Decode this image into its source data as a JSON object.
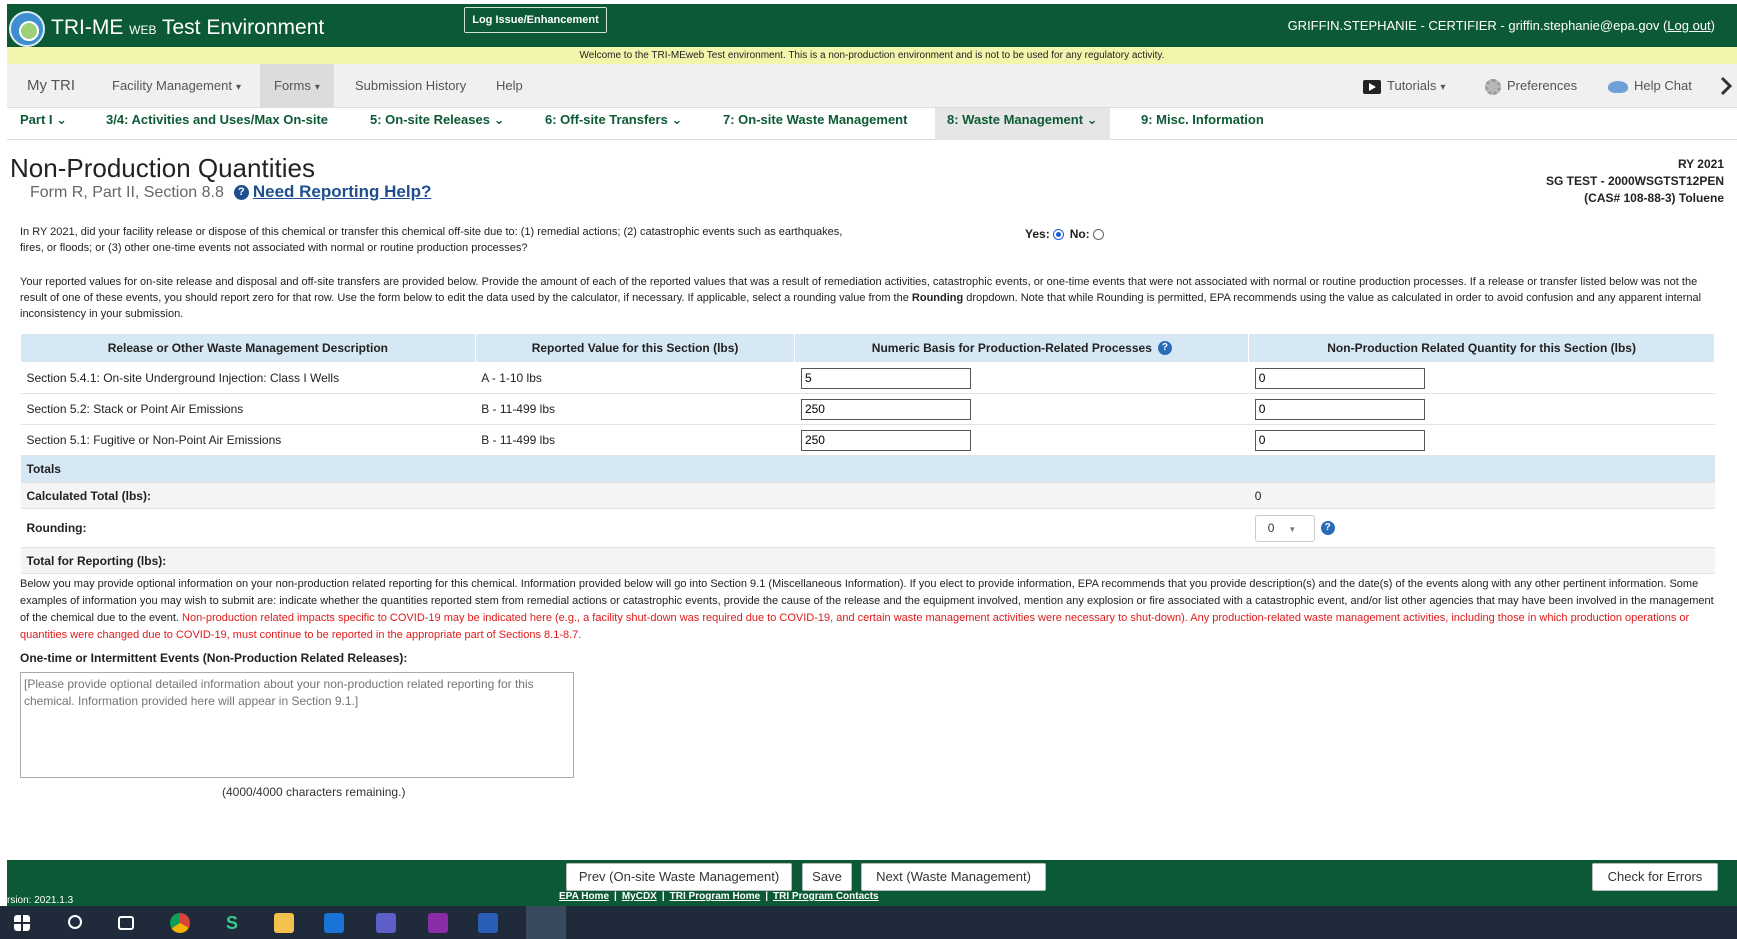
{
  "header": {
    "app_title_pre": "TRI-ME",
    "app_title_web": "WEB",
    "app_title_post": "Test Environment",
    "log_issue": "Log Issue/Enhancement",
    "user_text": "GRIFFIN.STEPHANIE - CERTIFIER - griffin.stephanie@epa.gov (",
    "logout": "Log out",
    "user_close": ")"
  },
  "welcome": "Welcome to the TRI-MEweb Test environment. This is a non-production environment and is not to be used for any regulatory activity.",
  "mainnav": {
    "my_tri": "My TRI",
    "facility": "Facility Management",
    "forms": "Forms",
    "history": "Submission History",
    "help": "Help",
    "tutorials": "Tutorials",
    "preferences": "Preferences",
    "help_chat": "Help Chat"
  },
  "subnav": [
    "Part I",
    "3/4: Activities and Uses/Max On-site",
    "5: On-site Releases",
    "6: Off-site Transfers",
    "7: On-site Waste Management",
    "8: Waste Management",
    "9: Misc. Information"
  ],
  "page": {
    "title": "Non-Production Quantities",
    "subtitle": "Form R, Part II, Section 8.8",
    "help_link": "Need Reporting Help?",
    "ry": "RY 2021",
    "facility": "SG TEST - 2000WSGTST12PEN",
    "chemical": "(CAS# 108-88-3) Toluene"
  },
  "question": {
    "text": "In RY 2021, did your facility release or dispose of this chemical or transfer this chemical off-site due to: (1) remedial actions; (2) catastrophic events such as earthquakes, fires, or floods; or (3) other one-time events not associated with normal or routine production processes?",
    "yes": "Yes:",
    "no": "No:"
  },
  "intro": {
    "part1": "Your reported values for on-site release and disposal and off-site transfers are provided below. Provide the amount of each of the reported values that was a result of remediation activities, catastrophic events, or one-time events that were not associated with normal or routine production processes. If a release or transfer listed below was not the result of one of these events, you should report zero for that row. Use the form below to edit the data used by the calculator, if necessary. If applicable, select a rounding value from the ",
    "bold": "Rounding",
    "part2": " dropdown. Note that while Rounding is permitted, EPA recommends using the value as calculated in order to avoid confusion and any apparent internal inconsistency in your submission."
  },
  "table": {
    "headers": [
      "Release or Other Waste Management Description",
      "Reported Value for this Section (lbs)",
      "Numeric Basis for Production-Related Processes",
      "Non-Production Related Quantity for this Section (lbs)"
    ],
    "rows": [
      {
        "desc": "Section 5.4.1: On-site Underground Injection: Class I Wells",
        "reported": "A - 1-10 lbs",
        "basis": "5",
        "nonprod": "0"
      },
      {
        "desc": "Section 5.2: Stack or Point Air Emissions",
        "reported": "B - 11-499 lbs",
        "basis": "250",
        "nonprod": "0"
      },
      {
        "desc": "Section 5.1: Fugitive or Non-Point Air Emissions",
        "reported": "B - 11-499 lbs",
        "basis": "250",
        "nonprod": "0"
      }
    ],
    "totals_label": "Totals",
    "calc_label": "Calculated Total (lbs):",
    "calc_value": "0",
    "rounding_label": "Rounding:",
    "rounding_value": "0",
    "final_label": "Total for Reporting (lbs):"
  },
  "optional": {
    "black": "Below you may provide optional information on your non-production related reporting for this chemical. Information provided below will go into Section 9.1 (Miscellaneous Information). If you elect to provide information, EPA recommends that you provide description(s) and the date(s) of the events along with any other pertinent information. Some examples of information you may wish to submit are: indicate whether the quantities reported stem from remedial actions or catastrophic events, provide the cause of the release and the equipment involved, mention any explosion or fire associated with a catastrophic event, and/or list other agencies that may have been involved in the management of the chemical due to the event. ",
    "red": "Non-production related impacts specific to COVID-19 may be indicated here (e.g., a facility shut-down was required due to COVID-19, and certain waste management activities were necessary to shut-down). Any production-related waste management activities, including those in which production operations or quantities were changed due to COVID-19, must continue to be reported in the appropriate part of Sections 8.1-8.7."
  },
  "events": {
    "label": "One-time or Intermittent Events (Non-Production Related Releases):",
    "placeholder": "[Please provide optional detailed information about your non-production related reporting for this chemical. Information provided here will appear in Section 9.1.]",
    "chars": "(4000/4000 characters remaining.)"
  },
  "footer": {
    "prev": "Prev (On-site Waste Management)",
    "save": "Save",
    "next": "Next (Waste Management)",
    "check": "Check for Errors",
    "version": "rsion: 2021.1.3",
    "links": [
      "EPA Home",
      "MyCDX",
      "TRI Program Home",
      "TRI Program Contacts"
    ]
  },
  "colors": {
    "header_green": "#0c5a35",
    "welcome_yellow": "#f2f6ad",
    "table_header_blue": "#d7e8f5",
    "warning_red": "#e01a1a",
    "link_blue": "#1f4f8f"
  }
}
